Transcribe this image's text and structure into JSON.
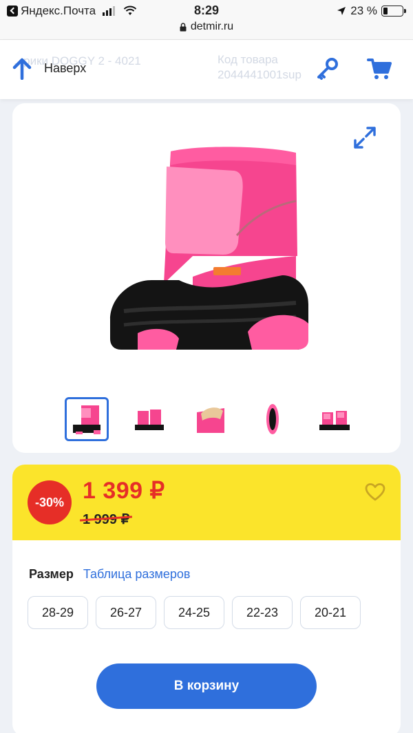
{
  "statusbar": {
    "back_app": "Яндекс.Почта",
    "time": "8:29",
    "url": "detmir.ru",
    "battery": "23 %",
    "battery_level": 0.23
  },
  "topbar": {
    "faded_product": "...рики DOGGY 2 - 4021",
    "faded_code_label": "Код товара",
    "faded_code_value": "2044441001sup",
    "up_label": "Наверх"
  },
  "colors": {
    "accent": "#2f6fdc",
    "sale_red": "#e62e27",
    "price_yellow": "#fbe42b"
  },
  "product": {
    "discount": "-30%",
    "price": "1 399 ₽",
    "old_price": "1 999 ₽"
  },
  "size": {
    "label": "Размер",
    "table_link": "Таблица размеров",
    "options": [
      "28-29",
      "26-27",
      "24-25",
      "22-23",
      "20-21"
    ]
  },
  "cart_button": "В корзину"
}
